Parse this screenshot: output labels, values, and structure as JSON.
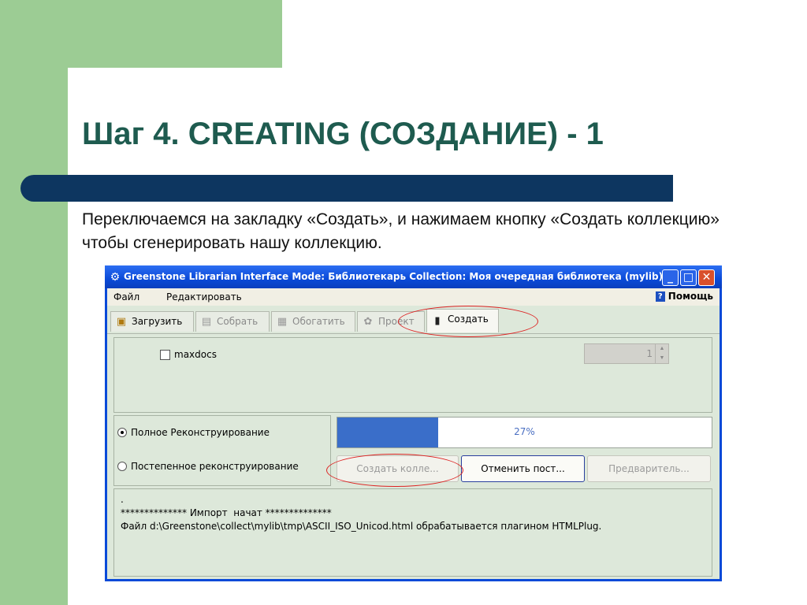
{
  "slide": {
    "title": "Шаг 4. CREATING (СОЗДАНИЕ) - 1",
    "text": "Переключаемся на закладку «Создать», и нажимаем кнопку «Создать коллекцию» чтобы сгенерировать нашу коллекцию."
  },
  "window": {
    "title": "Greenstone Librarian Interface  Mode: Библиотекарь  Collection: Моя очередная библиотека (mylib)",
    "controls": {
      "minimize": "_",
      "maximize": "□",
      "close": "✕"
    }
  },
  "menu": {
    "file": "Файл",
    "edit": "Редактировать",
    "help": "Помощь"
  },
  "tabs": [
    {
      "label": "Загрузить",
      "icon": "gather-icon"
    },
    {
      "label": "Собрать",
      "icon": "enrich-icon"
    },
    {
      "label": "Обогатить",
      "icon": "design-icon"
    },
    {
      "label": "Проект",
      "icon": "format-icon"
    },
    {
      "label": "Создать",
      "icon": "create-icon"
    }
  ],
  "options": {
    "maxdocs_label": "maxdocs",
    "maxdocs_checked": false,
    "maxdocs_value": "1"
  },
  "rebuild": {
    "full": "Полное Реконструирование",
    "incremental": "Постепенное реконструирование",
    "selected": "full"
  },
  "progress": {
    "value": 0.27,
    "text": "27%"
  },
  "buttons": {
    "build": "Создать колле...",
    "cancel": "Отменить пост...",
    "preview": "Предваритель..."
  },
  "log": ".\n************** Импорт  начат **************\nФайл d:\\Greenstone\\collect\\mylib\\tmp\\ASCII_ISO_Unicod.html обрабатывается плагином HTMLPlug.",
  "colors": {
    "accent": "#0a4ad8",
    "progress": "#3a6ec9",
    "annotation": "#dd2222",
    "slide_green": "#9ccc94",
    "title_bar": "#0d3660"
  }
}
